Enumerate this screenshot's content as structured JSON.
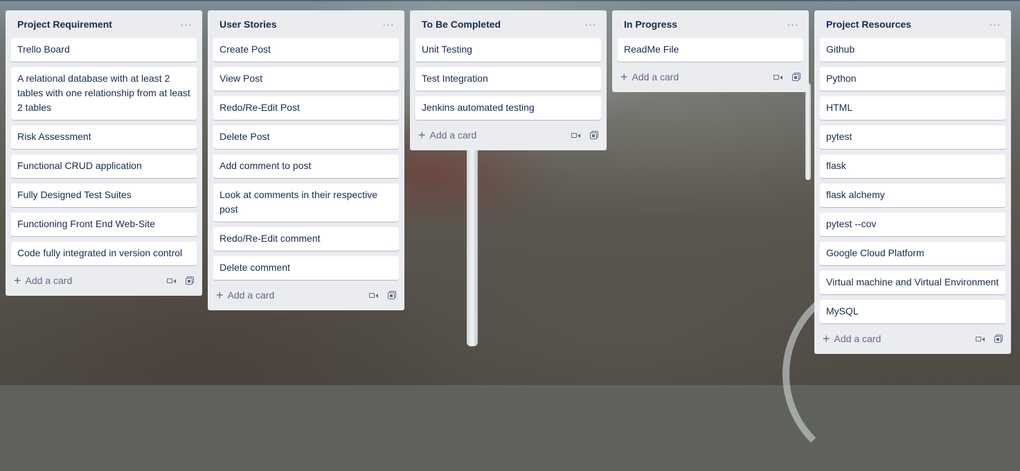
{
  "board": {
    "lists": [
      {
        "title": "Project Requirement",
        "menu": "···",
        "cards": [
          "Trello Board",
          "A relational database with at least 2 tables with one relationship from at least 2 tables",
          "Risk Assessment",
          "Functional CRUD application",
          "Fully Designed Test Suites",
          "Functioning Front End Web-Site",
          "Code fully integrated in version control"
        ],
        "add_label": "Add a card"
      },
      {
        "title": "User Stories",
        "menu": "···",
        "cards": [
          "Create Post",
          "View Post",
          "Redo/Re-Edit Post",
          "Delete Post",
          "Add comment to post",
          "Look at comments in their respective post",
          "Redo/Re-Edit comment",
          "Delete comment"
        ],
        "add_label": "Add a card"
      },
      {
        "title": "To Be Completed",
        "menu": "···",
        "cards": [
          "Unit Testing",
          "Test Integration",
          "Jenkins automated testing"
        ],
        "add_label": "Add a card"
      },
      {
        "title": "In Progress",
        "menu": "···",
        "cards": [
          "ReadMe File"
        ],
        "add_label": "Add a card"
      },
      {
        "title": "Project Resources",
        "menu": "···",
        "cards": [
          "Github",
          "Python",
          "HTML",
          "pytest",
          "flask",
          "flask alchemy",
          "pytest --cov",
          "Google Cloud Platform",
          "Virtual machine and Virtual Environment",
          "MySQL"
        ],
        "add_label": "Add a card"
      }
    ]
  },
  "icons": {
    "add": "plus-icon",
    "menu": "more-horizontal-icon",
    "camera": "video-camera-icon",
    "template": "card-template-icon"
  },
  "colors": {
    "list_bg": "#ebecf0",
    "card_bg": "#ffffff",
    "text": "#172b4d",
    "muted": "#5e6c84"
  }
}
